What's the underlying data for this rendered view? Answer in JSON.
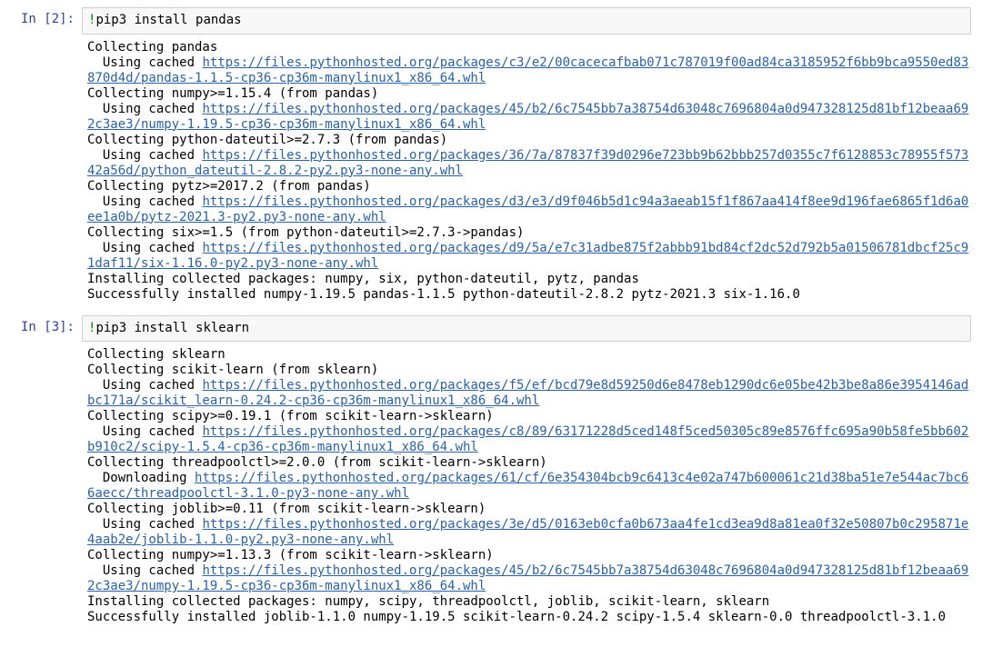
{
  "cells": [
    {
      "prompt": "In [2]:",
      "magic": "!",
      "code": "pip3 install pandas",
      "output_parts": [
        {
          "t": "plain",
          "v": "Collecting pandas\n  Using cached "
        },
        {
          "t": "link",
          "v": "https://files.pythonhosted.org/packages/c3/e2/00cacecafbab071c787019f00ad84ca3185952f6bb9bca9550ed83870d4d/pandas-1.1.5-cp36-cp36m-manylinux1_x86_64.whl"
        },
        {
          "t": "plain",
          "v": "\nCollecting numpy>=1.15.4 (from pandas)\n  Using cached "
        },
        {
          "t": "link",
          "v": "https://files.pythonhosted.org/packages/45/b2/6c7545bb7a38754d63048c7696804a0d947328125d81bf12beaa692c3ae3/numpy-1.19.5-cp36-cp36m-manylinux1_x86_64.whl"
        },
        {
          "t": "plain",
          "v": "\nCollecting python-dateutil>=2.7.3 (from pandas)\n  Using cached "
        },
        {
          "t": "link",
          "v": "https://files.pythonhosted.org/packages/36/7a/87837f39d0296e723bb9b62bbb257d0355c7f6128853c78955f57342a56d/python_dateutil-2.8.2-py2.py3-none-any.whl"
        },
        {
          "t": "plain",
          "v": "\nCollecting pytz>=2017.2 (from pandas)\n  Using cached "
        },
        {
          "t": "link",
          "v": "https://files.pythonhosted.org/packages/d3/e3/d9f046b5d1c94a3aeab15f1f867aa414f8ee9d196fae6865f1d6a0ee1a0b/pytz-2021.3-py2.py3-none-any.whl"
        },
        {
          "t": "plain",
          "v": "\nCollecting six>=1.5 (from python-dateutil>=2.7.3->pandas)\n  Using cached "
        },
        {
          "t": "link",
          "v": "https://files.pythonhosted.org/packages/d9/5a/e7c31adbe875f2abbb91bd84cf2dc52d792b5a01506781dbcf25c91daf11/six-1.16.0-py2.py3-none-any.whl"
        },
        {
          "t": "plain",
          "v": "\nInstalling collected packages: numpy, six, python-dateutil, pytz, pandas\nSuccessfully installed numpy-1.19.5 pandas-1.1.5 python-dateutil-2.8.2 pytz-2021.3 six-1.16.0"
        }
      ]
    },
    {
      "prompt": "In [3]:",
      "magic": "!",
      "code": "pip3 install sklearn",
      "output_parts": [
        {
          "t": "plain",
          "v": "Collecting sklearn\nCollecting scikit-learn (from sklearn)\n  Using cached "
        },
        {
          "t": "link",
          "v": "https://files.pythonhosted.org/packages/f5/ef/bcd79e8d59250d6e8478eb1290dc6e05be42b3be8a86e3954146adbc171a/scikit_learn-0.24.2-cp36-cp36m-manylinux1_x86_64.whl"
        },
        {
          "t": "plain",
          "v": "\nCollecting scipy>=0.19.1 (from scikit-learn->sklearn)\n  Using cached "
        },
        {
          "t": "link",
          "v": "https://files.pythonhosted.org/packages/c8/89/63171228d5ced148f5ced50305c89e8576ffc695a90b58fe5bb602b910c2/scipy-1.5.4-cp36-cp36m-manylinux1_x86_64.whl"
        },
        {
          "t": "plain",
          "v": "\nCollecting threadpoolctl>=2.0.0 (from scikit-learn->sklearn)\n  Downloading "
        },
        {
          "t": "link",
          "v": "https://files.pythonhosted.org/packages/61/cf/6e354304bcb9c6413c4e02a747b600061c21d38ba51e7e544ac7bc66aecc/threadpoolctl-3.1.0-py3-none-any.whl"
        },
        {
          "t": "plain",
          "v": "\nCollecting joblib>=0.11 (from scikit-learn->sklearn)\n  Using cached "
        },
        {
          "t": "link",
          "v": "https://files.pythonhosted.org/packages/3e/d5/0163eb0cfa0b673aa4fe1cd3ea9d8a81ea0f32e50807b0c295871e4aab2e/joblib-1.1.0-py2.py3-none-any.whl"
        },
        {
          "t": "plain",
          "v": "\nCollecting numpy>=1.13.3 (from scikit-learn->sklearn)\n  Using cached "
        },
        {
          "t": "link",
          "v": "https://files.pythonhosted.org/packages/45/b2/6c7545bb7a38754d63048c7696804a0d947328125d81bf12beaa692c3ae3/numpy-1.19.5-cp36-cp36m-manylinux1_x86_64.whl"
        },
        {
          "t": "plain",
          "v": "\nInstalling collected packages: numpy, scipy, threadpoolctl, joblib, scikit-learn, sklearn\nSuccessfully installed joblib-1.1.0 numpy-1.19.5 scikit-learn-0.24.2 scipy-1.5.4 sklearn-0.0 threadpoolctl-3.1.0"
        }
      ]
    }
  ]
}
